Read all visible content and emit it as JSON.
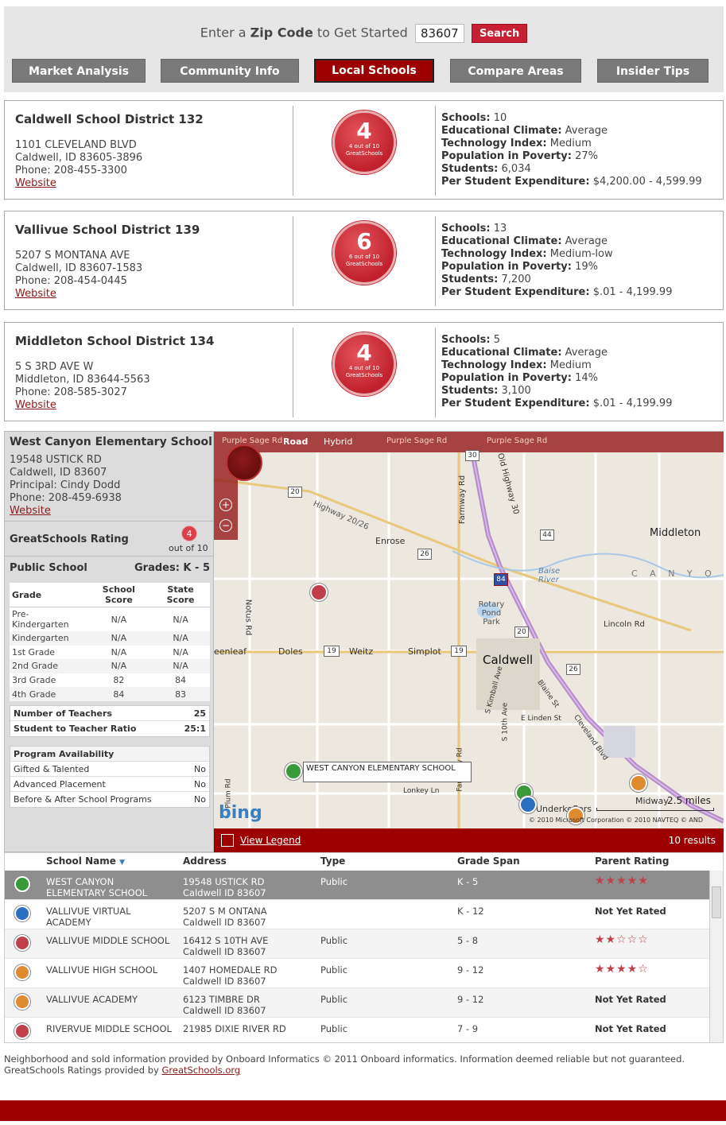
{
  "search": {
    "prompt_pre": "Enter a",
    "prompt_bold": "Zip Code",
    "prompt_post": "to Get Started",
    "zip_value": "83607",
    "button": "Search"
  },
  "nav": {
    "tabs": [
      {
        "label": "Market Analysis"
      },
      {
        "label": "Community Info"
      },
      {
        "label": "Local Schools",
        "active": true
      },
      {
        "label": "Compare Areas"
      },
      {
        "label": "Insider Tips"
      }
    ]
  },
  "districts": [
    {
      "name": "Caldwell School District 132",
      "address1": "1101 CLEVELAND BLVD",
      "address2": "Caldwell, ID 83605-3896",
      "phone": "Phone: 208-455-3300",
      "website": "Website",
      "rating": "4",
      "rating_sub": "4 out of 10",
      "rating_brand": "GreatSchools",
      "stats": [
        {
          "label": "Schools:",
          "value": "10"
        },
        {
          "label": "Educational Climate:",
          "value": "Average"
        },
        {
          "label": "Technology Index:",
          "value": "Medium"
        },
        {
          "label": "Population in Poverty:",
          "value": "27%"
        },
        {
          "label": "Students:",
          "value": "6,034"
        },
        {
          "label": "Per Student Expenditure:",
          "value": "$4,200.00 - 4,599.99"
        }
      ]
    },
    {
      "name": "Vallivue School District 139",
      "address1": "5207 S MONTANA AVE",
      "address2": "Caldwell, ID 83607-1583",
      "phone": "Phone: 208-454-0445",
      "website": "Website",
      "rating": "6",
      "rating_sub": "6 out of 10",
      "rating_brand": "GreatSchools",
      "stats": [
        {
          "label": "Schools:",
          "value": "13"
        },
        {
          "label": "Educational Climate:",
          "value": "Average"
        },
        {
          "label": "Technology Index:",
          "value": "Medium-low"
        },
        {
          "label": "Population in Poverty:",
          "value": "19%"
        },
        {
          "label": "Students:",
          "value": "7,200"
        },
        {
          "label": "Per Student Expenditure:",
          "value": "$.01 - 4,199.99"
        }
      ]
    },
    {
      "name": "Middleton School District 134",
      "address1": "5 S 3RD AVE W",
      "address2": "Middleton, ID 83644-5563",
      "phone": "Phone: 208-585-3027",
      "website": "Website",
      "rating": "4",
      "rating_sub": "4 out of 10",
      "rating_brand": "GreatSchools",
      "stats": [
        {
          "label": "Schools:",
          "value": "5"
        },
        {
          "label": "Educational Climate:",
          "value": "Average"
        },
        {
          "label": "Technology Index:",
          "value": "Medium"
        },
        {
          "label": "Population in Poverty:",
          "value": "14%"
        },
        {
          "label": "Students:",
          "value": "3,100"
        },
        {
          "label": "Per Student Expenditure:",
          "value": "$.01 - 4,199.99"
        }
      ]
    }
  ],
  "school": {
    "name": "West Canyon Elementary School",
    "address1": "19548 USTICK RD",
    "address2": "Caldwell, ID 83607",
    "principal": "Principal: Cindy Dodd",
    "phone": "Phone: 208-459-6938",
    "website": "Website",
    "gs_label": "GreatSchools Rating",
    "gs_rating": "4",
    "gs_outof": "out of 10",
    "type": "Public School",
    "grades": "Grades: K - 5",
    "grade_table": {
      "headers": [
        "Grade",
        "School Score",
        "State Score"
      ],
      "rows": [
        [
          "Pre-Kindergarten",
          "N/A",
          "N/A"
        ],
        [
          "Kindergarten",
          "N/A",
          "N/A"
        ],
        [
          "1st Grade",
          "N/A",
          "N/A"
        ],
        [
          "2nd Grade",
          "N/A",
          "N/A"
        ],
        [
          "3rd Grade",
          "82",
          "84"
        ],
        [
          "4th Grade",
          "84",
          "83"
        ]
      ]
    },
    "teachers": {
      "label": "Number of Teachers",
      "value": "25"
    },
    "ratio": {
      "label": "Student to Teacher Ratio",
      "value": "25:1"
    },
    "programs": {
      "header": "Program Availability",
      "rows": [
        {
          "label": "Gifted & Talented",
          "value": "No"
        },
        {
          "label": "Advanced Placement",
          "value": "No"
        },
        {
          "label": "Before & After School Programs",
          "value": "No"
        }
      ]
    }
  },
  "map": {
    "tab_road": "Road",
    "tab_hybrid": "Hybrid",
    "labels": {
      "purple_sage_1": "Purple Sage Rd",
      "purple_sage_2": "Purple Sage Rd",
      "purple_sage_3": "Purple Sage Rd",
      "highway": "Highway 20/26",
      "enrose": "Enrose",
      "middleton": "Middleton",
      "canyon": "C A N Y O",
      "boise_river": "Baise River",
      "rotary": "Rotary Pond Park",
      "lincoln": "Lincoln Rd",
      "caldwell": "Caldwell",
      "doles": "Doles",
      "weitz": "Weitz",
      "simplot": "Simplot",
      "greenleaf": "eenleaf",
      "notus": "Notus Rd",
      "farmway": "Farmway Rd",
      "old_hwy": "Old Highway 30",
      "kimball": "S Kimball Ave",
      "tenth": "S 10th Ave",
      "blaine": "Blaine St",
      "linden": "E Linden St",
      "cleveland": "Cleveland Blvd",
      "lonkey": "Lonkey Ln",
      "plum": "Plum Rd",
      "midway": "Midway",
      "underkoflers": "Underkoflers",
      "school_tooltip": "WEST CANYON ELEMENTARY SCHOOL",
      "scale": "2.5 miles",
      "copyright": "© 2010 Microsoft Corporation   © 2010 NAVTEQ   © AND",
      "bing": "bing",
      "r30": "30",
      "r20a": "20",
      "r20b": "20",
      "r26a": "26",
      "r26b": "26",
      "r44": "44",
      "r84": "84",
      "r19a": "19",
      "r19b": "19"
    },
    "legend_link": "View Legend",
    "results": "10 results"
  },
  "results_table": {
    "headers": {
      "name": "School Name",
      "address": "Address",
      "type": "Type",
      "grade": "Grade Span",
      "rating": "Parent Rating"
    },
    "rows": [
      {
        "name": "WEST CANYON ELEMENTARY SCHOOL",
        "addr1": "19548 USTICK RD",
        "addr2": "Caldwell ID 83607",
        "type": "Public",
        "grade": "K - 5",
        "rating": "★★★★★",
        "color": "#3a9a3a"
      },
      {
        "name": "VALLIVUE VIRTUAL ACADEMY",
        "addr1": "5207 S M ONTANA",
        "addr2": "Caldwell ID 83607",
        "type": "",
        "grade": "K - 12",
        "rating": "Not Yet Rated",
        "color": "#2a6fc0"
      },
      {
        "name": "VALLIVUE MIDDLE SCHOOL",
        "addr1": "16412 S 10TH AVE",
        "addr2": "Caldwell ID 83607",
        "type": "Public",
        "grade": "5 - 8",
        "rating": "★★☆☆☆",
        "color": "#c0404a"
      },
      {
        "name": "VALLIVUE HIGH SCHOOL",
        "addr1": "1407 HOMEDALE RD",
        "addr2": "Caldwell ID 83607",
        "type": "Public",
        "grade": "9 - 12",
        "rating": "★★★★☆",
        "color": "#e08a30"
      },
      {
        "name": "VALLIVUE ACADEMY",
        "addr1": "6123 TIMBRE DR",
        "addr2": "Caldwell ID 83607",
        "type": "Public",
        "grade": "9 - 12",
        "rating": "Not Yet Rated",
        "color": "#e08a30"
      },
      {
        "name": "RIVERVUE MIDDLE SCHOOL",
        "addr1": "21985 DIXIE RIVER RD",
        "addr2": "",
        "type": "Public",
        "grade": "7 - 9",
        "rating": "Not Yet Rated",
        "color": "#c0404a"
      }
    ]
  },
  "footer": {
    "line1": "Neighborhood and sold information provided by Onboard Informatics © 2011 Onboard informatics. Information deemed reliable but not guaranteed.",
    "line2_pre": "GreatSchools Ratings provided by",
    "line2_link": "GreatSchools.org"
  }
}
